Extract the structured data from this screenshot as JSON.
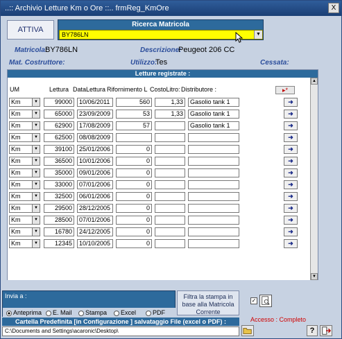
{
  "window": {
    "title": "..:: Archivio Letture  Km o Ore ::..   frmReg_KmOre",
    "close_label": "X"
  },
  "attiva_label": "ATTIVA",
  "ricerca": {
    "title": "Ricerca Matricola",
    "value": "BY786LN"
  },
  "info": {
    "matricola_label": "Matricola:",
    "matricola_value": "BY786LN",
    "descrizione_label": "Descrizione:",
    "descrizione_value": "Peugeot 206 CC",
    "costruttore_label": "Mat. Costruttore:",
    "utilizzo_label": "Utilizzo:",
    "utilizzo_value": "Tes",
    "cessata_label": "Cessata:"
  },
  "grid": {
    "title": "Letture registrate :",
    "headers": {
      "um": "UM",
      "lettura": "Lettura",
      "data": "DataLettura",
      "rif": "Rifornimento L",
      "costo": "CostoLitro:",
      "dist": "Distributore :"
    },
    "new_label": "▸*",
    "rows": [
      {
        "um": "Km",
        "lettura": "99000",
        "data": "10/06/2011",
        "rif": "560",
        "costo": "1,33",
        "dist": "Gasolio tank 1"
      },
      {
        "um": "Km",
        "lettura": "65000",
        "data": "23/09/2009",
        "rif": "53",
        "costo": "1,33",
        "dist": "Gasolio tank 1"
      },
      {
        "um": "Km",
        "lettura": "62900",
        "data": "17/08/2009",
        "rif": "57",
        "costo": "",
        "dist": "Gasolio tank 1"
      },
      {
        "um": "Km",
        "lettura": "62500",
        "data": "08/08/2009",
        "rif": "",
        "costo": "",
        "dist": ""
      },
      {
        "um": "Km",
        "lettura": "39100",
        "data": "25/01/2006",
        "rif": "0",
        "costo": "",
        "dist": ""
      },
      {
        "um": "Km",
        "lettura": "36500",
        "data": "10/01/2006",
        "rif": "0",
        "costo": "",
        "dist": ""
      },
      {
        "um": "Km",
        "lettura": "35000",
        "data": "09/01/2006",
        "rif": "0",
        "costo": "",
        "dist": ""
      },
      {
        "um": "Km",
        "lettura": "33000",
        "data": "07/01/2006",
        "rif": "0",
        "costo": "",
        "dist": ""
      },
      {
        "um": "Km",
        "lettura": "32500",
        "data": "06/01/2006",
        "rif": "0",
        "costo": "",
        "dist": ""
      },
      {
        "um": "Km",
        "lettura": "29500",
        "data": "28/12/2005",
        "rif": "0",
        "costo": "",
        "dist": ""
      },
      {
        "um": "Km",
        "lettura": "28500",
        "data": "07/01/2006",
        "rif": "0",
        "costo": "",
        "dist": ""
      },
      {
        "um": "Km",
        "lettura": "16780",
        "data": "24/12/2005",
        "rif": "0",
        "costo": "",
        "dist": ""
      },
      {
        "um": "Km",
        "lettura": "12345",
        "data": "10/10/2005",
        "rif": "0",
        "costo": "",
        "dist": ""
      }
    ]
  },
  "invia": {
    "title": "Invia a :",
    "options": [
      "Anteprima",
      "E. Mail",
      "Stampa",
      "Excel",
      "PDF"
    ],
    "selected": "Anteprima"
  },
  "filtra_text": "Filtra la stampa in base alla Matricola Corrente",
  "accesso_text": "Accesso : Completo",
  "cartella_title": "Cartella Predefinita [in Configurazione ] salvataggio File (excel o PDF) :",
  "cartella_path": "C:\\Documents and Settings\\acaronic\\Desktop\\",
  "help_label": "?",
  "check_mark": "✓"
}
